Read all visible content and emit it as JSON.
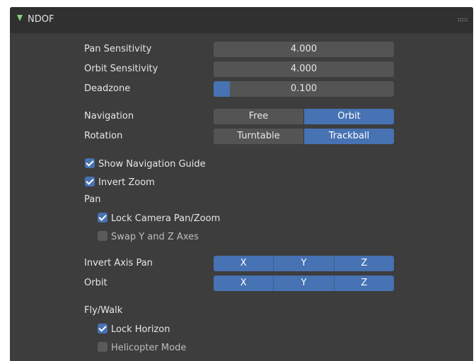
{
  "header": {
    "title": "NDOF"
  },
  "fields": {
    "pan_sensitivity": {
      "label": "Pan Sensitivity",
      "value": "4.000"
    },
    "orbit_sensitivity": {
      "label": "Orbit Sensitivity",
      "value": "4.000"
    },
    "deadzone": {
      "label": "Deadzone",
      "value": "0.100",
      "fill_fraction": 0.09
    }
  },
  "navigation": {
    "label": "Navigation",
    "options": [
      "Free",
      "Orbit"
    ],
    "selected": "Orbit"
  },
  "rotation": {
    "label": "Rotation",
    "options": [
      "Turntable",
      "Trackball"
    ],
    "selected": "Trackball"
  },
  "checks": {
    "show_nav_guide": {
      "label": "Show Navigation Guide",
      "checked": true
    },
    "invert_zoom": {
      "label": "Invert Zoom",
      "checked": true
    }
  },
  "pan": {
    "heading": "Pan",
    "lock_camera": {
      "label": "Lock Camera Pan/Zoom",
      "checked": true
    },
    "swap_axes": {
      "label": "Swap Y and Z Axes",
      "checked": false
    }
  },
  "invert_axis_pan": {
    "label": "Invert Axis Pan",
    "axes": [
      "X",
      "Y",
      "Z"
    ]
  },
  "orbit_axes": {
    "label": "Orbit",
    "axes": [
      "X",
      "Y",
      "Z"
    ]
  },
  "flywalk": {
    "heading": "Fly/Walk",
    "lock_horizon": {
      "label": "Lock Horizon",
      "checked": true
    },
    "helicopter": {
      "label": "Helicopter Mode",
      "checked": false
    }
  },
  "colors": {
    "accent": "#4772b3",
    "panel": "#3d3d3d",
    "field": "#545454",
    "expand_arrow": "#7fd37c"
  }
}
